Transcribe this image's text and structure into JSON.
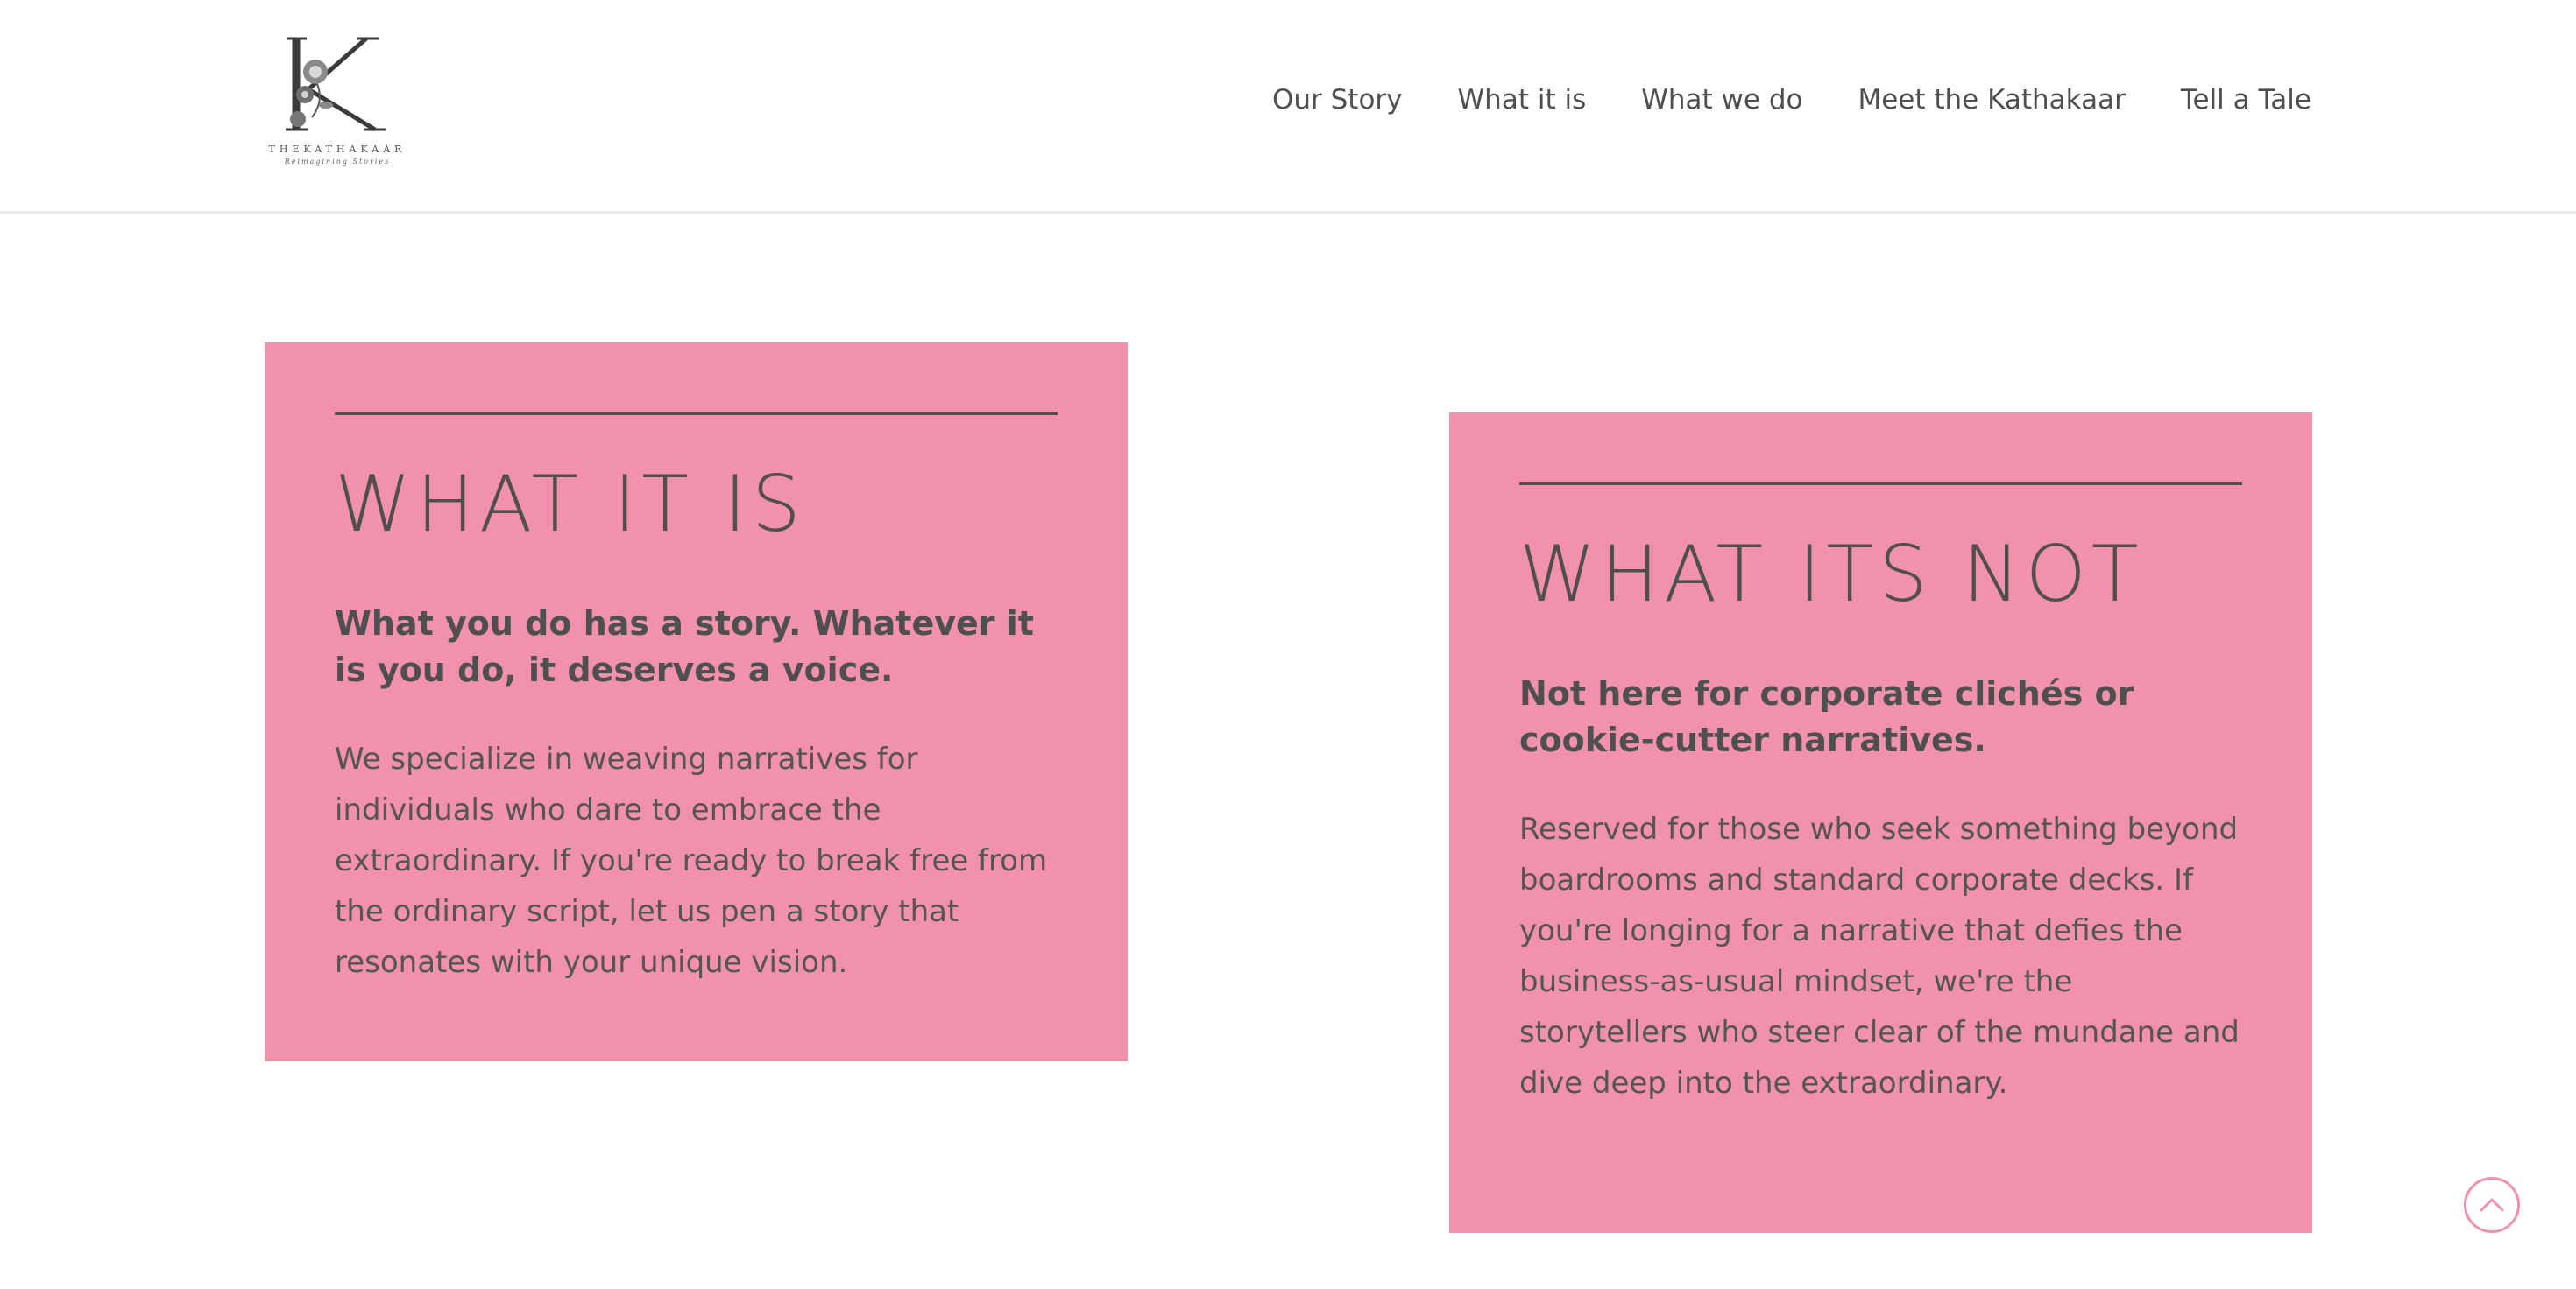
{
  "brand": {
    "logo_letter": "K",
    "name": "THEKATHAKAAR",
    "tagline": "Reimagining Stories"
  },
  "nav": {
    "items": [
      {
        "label": "Our Story"
      },
      {
        "label": "What it is"
      },
      {
        "label": "What we do"
      },
      {
        "label": "Meet the Kathakaar"
      },
      {
        "label": "Tell a Tale"
      }
    ]
  },
  "cards": {
    "left": {
      "title": "WHAT IT IS",
      "lead": "What you do has a story. Whatever it is you do, it deserves a voice.",
      "body": "We specialize in weaving narratives for individuals who dare to embrace the extraordinary. If you're ready to break free from the ordinary script, let us pen a story that resonates with your unique vision."
    },
    "right": {
      "title": "WHAT ITS NOT",
      "lead": "Not here for corporate clichés or cookie-cutter narratives.",
      "body": "Reserved for those who seek something beyond boardrooms and standard corporate decks. If you're longing for a narrative that defies the business-as-usual mindset, we're the storytellers who steer clear of the mundane and dive deep into the extraordinary."
    }
  },
  "colors": {
    "card_background": "#f191ab",
    "text": "#4f4f4f",
    "accent": "#f191ab"
  },
  "icons": {
    "scroll_top": "chevron-up-icon",
    "logo_flower": "flower-icon"
  }
}
